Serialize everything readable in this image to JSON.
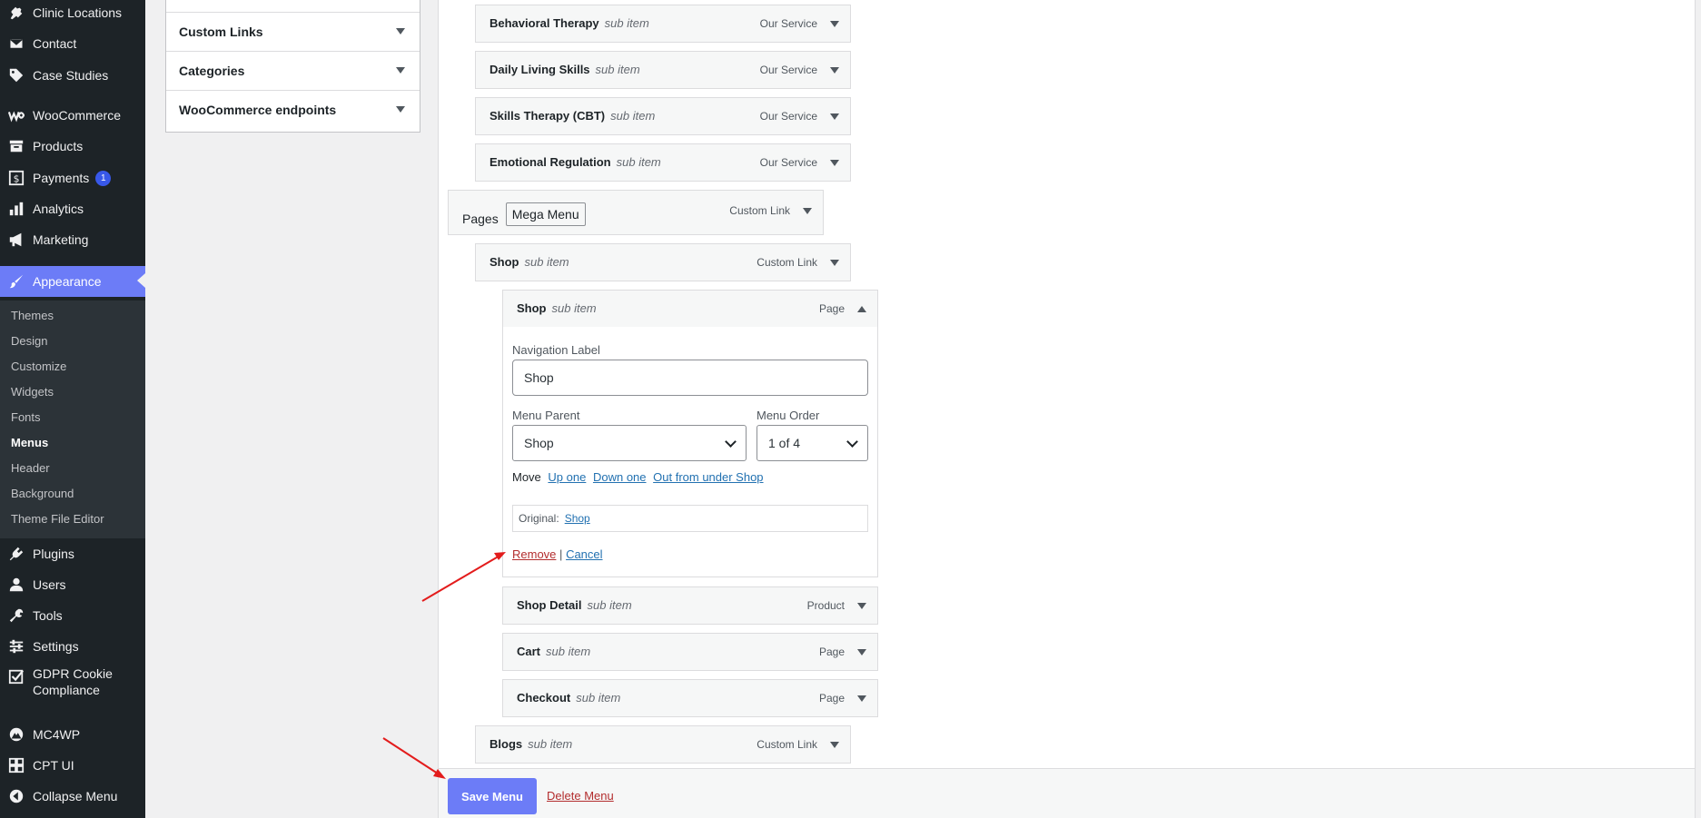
{
  "sidebar": {
    "items": [
      {
        "label": "Clinic Locations",
        "icon": "pin-icon"
      },
      {
        "label": "Contact",
        "icon": "mail-icon"
      },
      {
        "label": "Case Studies",
        "icon": "tag-icon"
      },
      {
        "label": "WooCommerce",
        "icon": "woo-icon"
      },
      {
        "label": "Products",
        "icon": "archive-icon"
      },
      {
        "label": "Payments",
        "icon": "dollar-icon",
        "badge": "1"
      },
      {
        "label": "Analytics",
        "icon": "bar-chart-icon"
      },
      {
        "label": "Marketing",
        "icon": "megaphone-icon"
      },
      {
        "label": "Appearance",
        "icon": "brush-icon"
      },
      {
        "label": "Plugins",
        "icon": "plug-icon"
      },
      {
        "label": "Users",
        "icon": "user-icon"
      },
      {
        "label": "Tools",
        "icon": "wrench-icon"
      },
      {
        "label": "Settings",
        "icon": "sliders-icon"
      },
      {
        "label": "GDPR Cookie",
        "label2": "Compliance",
        "icon": "check-square-icon"
      },
      {
        "label": "MC4WP",
        "icon": "mountain-icon"
      },
      {
        "label": "CPT UI",
        "icon": "grid-icon"
      },
      {
        "label": "Collapse Menu",
        "icon": "collapse-icon"
      }
    ],
    "submenu": [
      "Themes",
      "Design",
      "Customize",
      "Widgets",
      "Fonts",
      "Menus",
      "Header",
      "Background",
      "Theme File Editor"
    ]
  },
  "accordion": {
    "items": [
      "Custom Links",
      "Categories",
      "WooCommerce endpoints"
    ]
  },
  "menu_items": [
    {
      "title": "Behavioral Therapy",
      "sub": "sub item",
      "type": "Our Service"
    },
    {
      "title": "Daily Living Skills",
      "sub": "sub item",
      "type": "Our Service"
    },
    {
      "title": "Skills Therapy (CBT)",
      "sub": "sub item",
      "type": "Our Service"
    },
    {
      "title": "Emotional Regulation",
      "sub": "sub item",
      "type": "Our Service"
    },
    {
      "title": "Pages",
      "mega": "Mega Menu",
      "type": "Custom Link"
    },
    {
      "title": "Shop",
      "sub": "sub item",
      "type": "Custom Link"
    },
    {
      "title": "Shop",
      "sub": "sub item",
      "type": "Page"
    },
    {
      "title": "Shop Detail",
      "sub": "sub item",
      "type": "Product"
    },
    {
      "title": "Cart",
      "sub": "sub item",
      "type": "Page"
    },
    {
      "title": "Checkout",
      "sub": "sub item",
      "type": "Page"
    },
    {
      "title": "Blogs",
      "sub": "sub item",
      "type": "Custom Link"
    }
  ],
  "settings": {
    "nav_label_label": "Navigation Label",
    "nav_label_value": "Shop",
    "menu_parent_label": "Menu Parent",
    "menu_parent_value": "Shop",
    "menu_order_label": "Menu Order",
    "menu_order_value": "1 of 4",
    "move_label": "Move",
    "up_one": "Up one",
    "down_one": "Down one",
    "out_from_under": "Out from under Shop",
    "original_label": "Original:",
    "original_link": "Shop",
    "remove": "Remove",
    "separator": "|",
    "cancel": "Cancel"
  },
  "footer": {
    "save": "Save Menu",
    "delete": "Delete Menu"
  },
  "colors": {
    "accent": "#6c7cf7",
    "danger": "#b32d2e",
    "link": "#2271b1",
    "annotation": "#e31c1c"
  }
}
